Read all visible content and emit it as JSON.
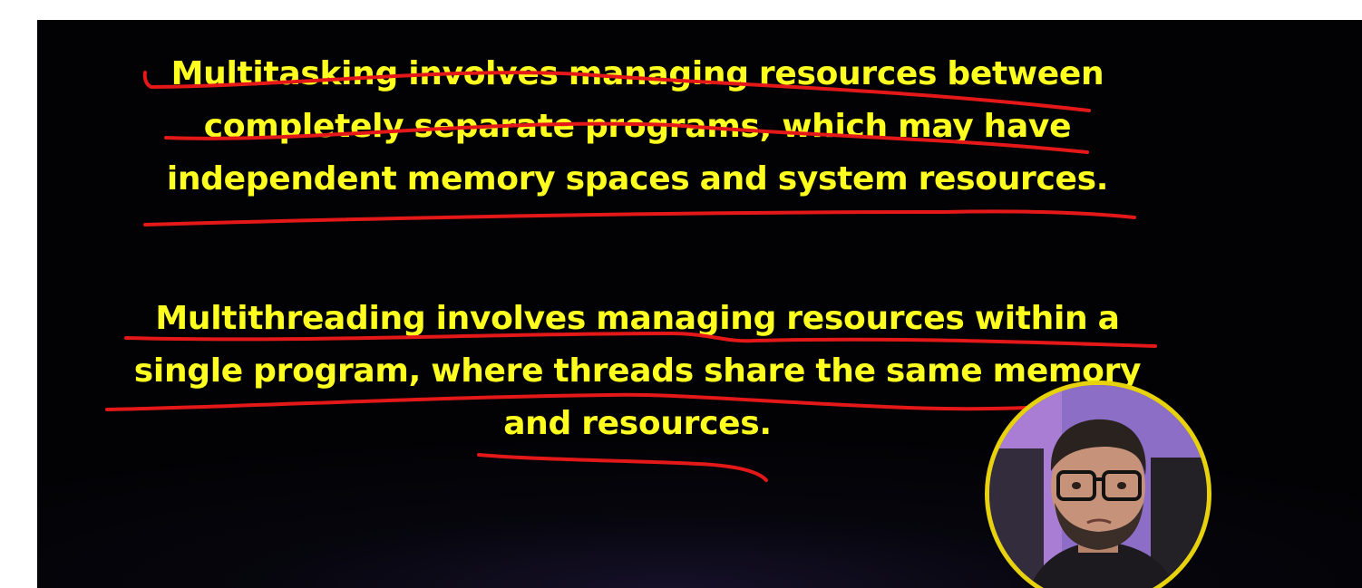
{
  "slide": {
    "paragraphs": [
      {
        "lines": [
          "Multitasking involves managing resources between",
          "completely separate programs, which may have",
          "independent memory spaces and system resources."
        ]
      },
      {
        "lines": [
          "Multithreading involves managing resources within a",
          "single program, where threads share the same memory",
          "and resources."
        ]
      }
    ],
    "colors": {
      "background": "#020204",
      "text": "#ffff1f",
      "annotation": "#e41818",
      "webcam_ring": "#e7d20b"
    }
  },
  "overlay": {
    "webcam": "presenter-webcam",
    "annotation_icon": "red-underline-strokes"
  }
}
